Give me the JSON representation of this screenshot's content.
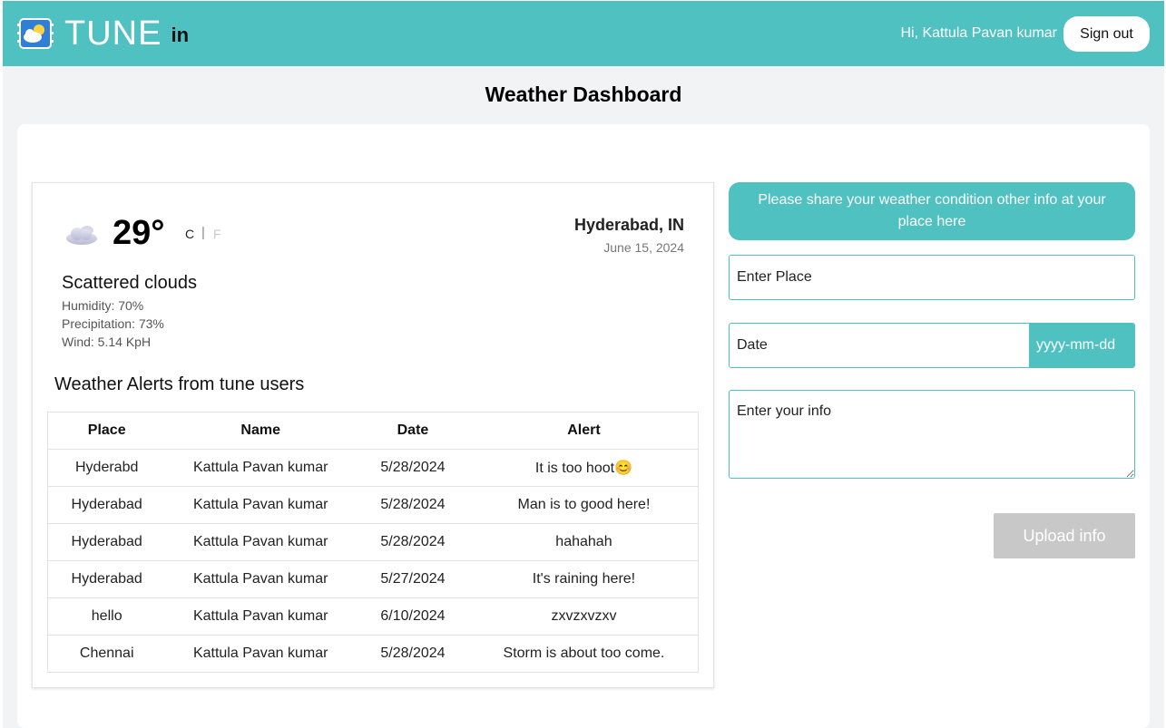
{
  "header": {
    "brand_main": "TUNE",
    "brand_sub": "in",
    "greeting": "Hi, Kattula Pavan kumar",
    "signout_label": "Sign out"
  },
  "page": {
    "title": "Weather Dashboard"
  },
  "weather": {
    "icon": "cloud-icon",
    "temperature": "29°",
    "unit_c": "C",
    "unit_sep": "|",
    "unit_f": "F",
    "location": "Hyderabad, IN",
    "date": "June 15, 2024",
    "condition": "Scattered clouds",
    "humidity": "Humidity: 70%",
    "precipitation": "Precipitation: 73%",
    "wind": "Wind: 5.14 KpH"
  },
  "alerts": {
    "heading": "Weather Alerts from tune users",
    "columns": [
      "Place",
      "Name",
      "Date",
      "Alert"
    ],
    "rows": [
      [
        "Hyderabd",
        "Kattula Pavan kumar",
        "5/28/2024",
        "It is too hoot😊"
      ],
      [
        "Hyderabad",
        "Kattula Pavan kumar",
        "5/28/2024",
        "Man is to good here!"
      ],
      [
        "Hyderabad",
        "Kattula Pavan kumar",
        "5/28/2024",
        "hahahah"
      ],
      [
        "Hyderabad",
        "Kattula Pavan kumar",
        "5/27/2024",
        "It's raining here!"
      ],
      [
        "hello",
        "Kattula Pavan kumar",
        "6/10/2024",
        "zxvzxvzxv"
      ],
      [
        "Chennai",
        "Kattula Pavan kumar",
        "5/28/2024",
        "Storm is about too come."
      ]
    ]
  },
  "form": {
    "banner": "Please share your weather condition other info at your place here",
    "place_placeholder": "Enter Place",
    "date_label": "Date",
    "date_placeholder": "yyyy-mm-dd",
    "info_placeholder": "Enter your info",
    "upload_label": "Upload info"
  },
  "colors": {
    "accent": "#4fc1c1",
    "background": "#f2f3f5",
    "disabled_button": "#c8c8c8"
  }
}
